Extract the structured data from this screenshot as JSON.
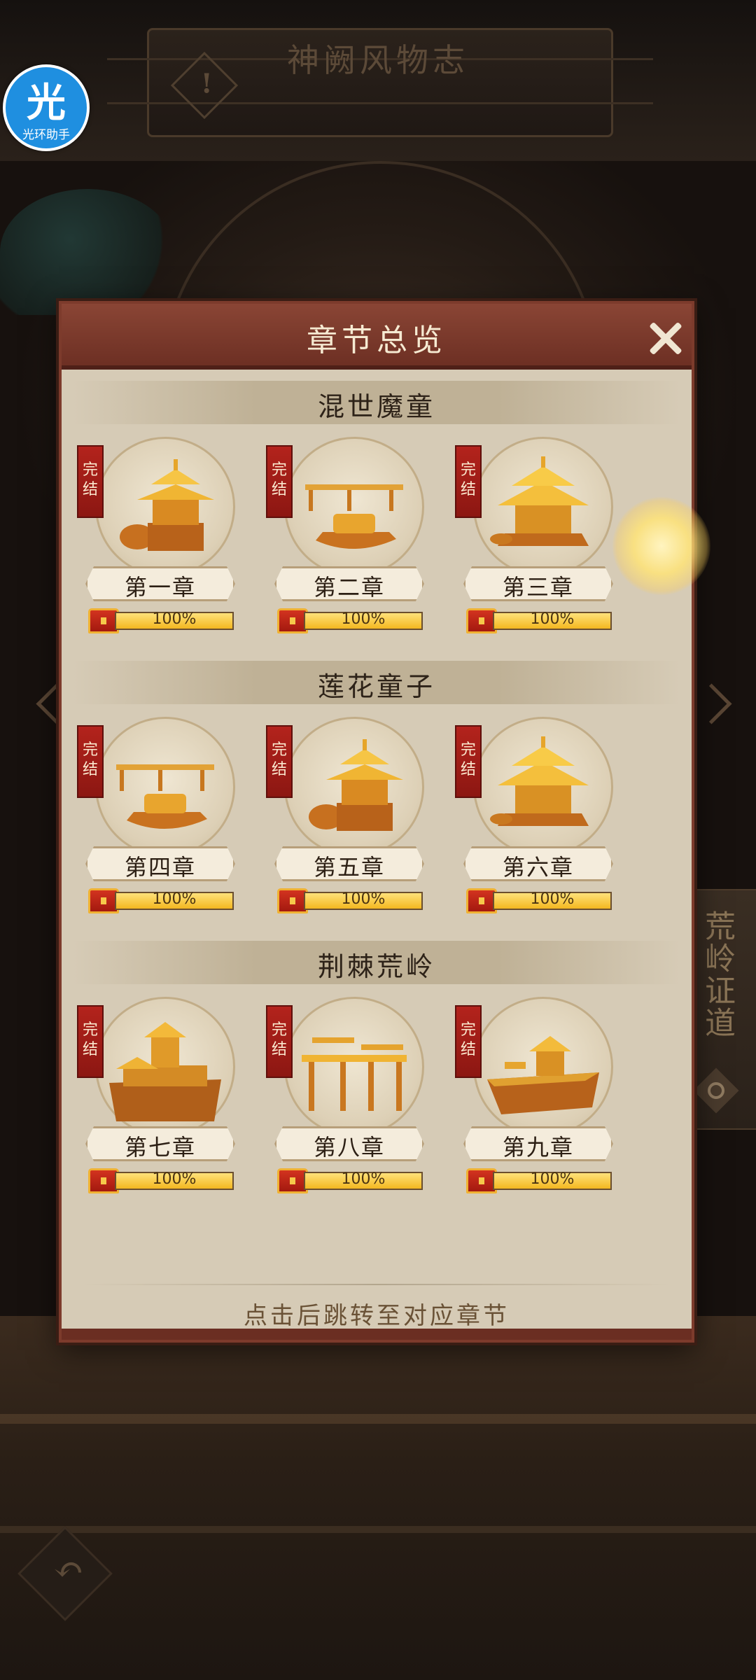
{
  "background": {
    "title": "神阙风物志",
    "warning_glyph": "!",
    "side_tab": "荒岭证道",
    "back_glyph": "↶"
  },
  "overlay_logo": {
    "char": "光",
    "text": "光环助手",
    "color": "#1f8fe0"
  },
  "modal": {
    "title": "章节总览",
    "footer": "点击后跳转至对应章节"
  },
  "sections": [
    {
      "title": "混世魔童"
    },
    {
      "title": "莲花童子"
    },
    {
      "title": "荆棘荒岭"
    }
  ],
  "chapters": [
    {
      "name": "第一章",
      "badge": [
        "完",
        "结"
      ],
      "progress": "100%",
      "fill": 1.0,
      "icon": "pavilion-icon"
    },
    {
      "name": "第二章",
      "badge": [
        "完",
        "结"
      ],
      "progress": "100%",
      "fill": 1.0,
      "icon": "boat-bridge-icon"
    },
    {
      "name": "第三章",
      "badge": [
        "完",
        "结"
      ],
      "progress": "100%",
      "fill": 1.0,
      "icon": "pagoda-icon"
    },
    {
      "name": "第四章",
      "badge": [
        "完",
        "结"
      ],
      "progress": "100%",
      "fill": 1.0,
      "icon": "boat-bridge-icon"
    },
    {
      "name": "第五章",
      "badge": [
        "完",
        "结"
      ],
      "progress": "100%",
      "fill": 1.0,
      "icon": "pavilion-icon"
    },
    {
      "name": "第六章",
      "badge": [
        "完",
        "结"
      ],
      "progress": "100%",
      "fill": 1.0,
      "icon": "pagoda-icon"
    },
    {
      "name": "第七章",
      "badge": [
        "完",
        "结"
      ],
      "progress": "100%",
      "fill": 1.0,
      "icon": "fortress-icon"
    },
    {
      "name": "第八章",
      "badge": [
        "完",
        "结"
      ],
      "progress": "100%",
      "fill": 1.0,
      "icon": "gate-icon"
    },
    {
      "name": "第九章",
      "badge": [
        "完",
        "结"
      ],
      "progress": "100%",
      "fill": 1.0,
      "icon": "cliff-temple-icon"
    }
  ],
  "colors": {
    "gold": "#e8a62a",
    "header": "#7d3b2c",
    "badge": "#a31d16"
  }
}
